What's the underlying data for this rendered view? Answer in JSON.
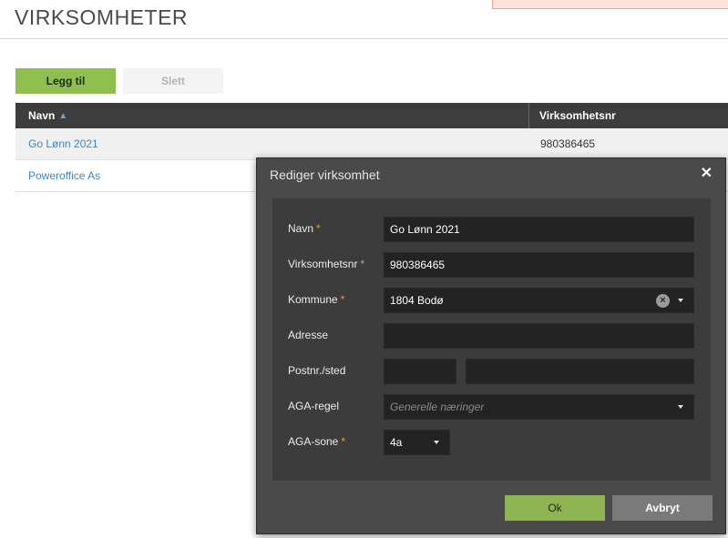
{
  "page": {
    "title": "VIRKSOMHETER"
  },
  "toolbar": {
    "add_label": "Legg til",
    "delete_label": "Slett"
  },
  "grid": {
    "columns": [
      "Navn",
      "Virksomhetsnr"
    ],
    "sort_icon": "sort-asc-icon",
    "rows": [
      {
        "navn": "Go Lønn 2021",
        "virksomhetsnr": "980386465"
      },
      {
        "navn": "Poweroffice As",
        "virksomhetsnr": ""
      }
    ]
  },
  "modal": {
    "title": "Rediger virksomhet",
    "close_icon": "close-icon",
    "fields": {
      "navn": {
        "label": "Navn",
        "required": "*",
        "value": "Go Lønn 2021"
      },
      "virksomhetsnr": {
        "label": "Virksomhetsnr",
        "required": "*",
        "value": "980386465"
      },
      "kommune": {
        "label": "Kommune",
        "required": "*",
        "value": "1804 Bodø"
      },
      "adresse": {
        "label": "Adresse",
        "value": ""
      },
      "postnr": {
        "label": "Postnr./sted",
        "value_postnr": "",
        "value_sted": ""
      },
      "aga_regel": {
        "label": "AGA-regel",
        "placeholder": "Generelle næringer"
      },
      "aga_sone": {
        "label": "AGA-sone",
        "required": "*",
        "value": "4a"
      }
    },
    "ok_label": "Ok",
    "cancel_label": "Avbryt"
  },
  "colors": {
    "primary_green": "#8fbf4f",
    "header_dark": "#3d3d3d",
    "link_blue": "#3a87c8",
    "required_orange": "#e39b3a",
    "modal_bg": "#4a4a4a"
  }
}
